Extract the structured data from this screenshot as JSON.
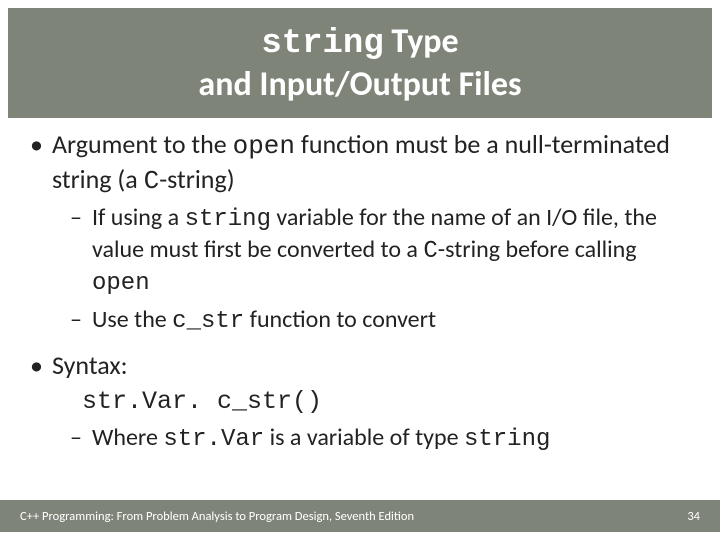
{
  "title": {
    "line1_code": "string",
    "line1_rest": " Type",
    "line2": "and Input/Output Files"
  },
  "bullets": {
    "b1_pre": "Argument to the ",
    "b1_code": "open",
    "b1_post": " function must be a null-terminated string (a ",
    "b1_cstr": "C",
    "b1_tail": "-string)",
    "b1_sub1_pre": "If using a ",
    "b1_sub1_code1": "string",
    "b1_sub1_mid": " variable for the name of an I/O file, the value must first be converted to a ",
    "b1_sub1_code2": "C",
    "b1_sub1_post": "-string before calling ",
    "b1_sub1_code3": "open",
    "b1_sub2_pre": "Use the ",
    "b1_sub2_code": "c_str",
    "b1_sub2_post": " function to convert",
    "b2": "Syntax:",
    "syntax": "str.Var. c_str()",
    "b2_sub1_pre": "Where ",
    "b2_sub1_code1": "str.Var",
    "b2_sub1_mid": " is a variable of type ",
    "b2_sub1_code2": "string"
  },
  "footer": {
    "left": "C++ Programming: From Problem Analysis to Program Design, Seventh Edition",
    "right": "34"
  }
}
